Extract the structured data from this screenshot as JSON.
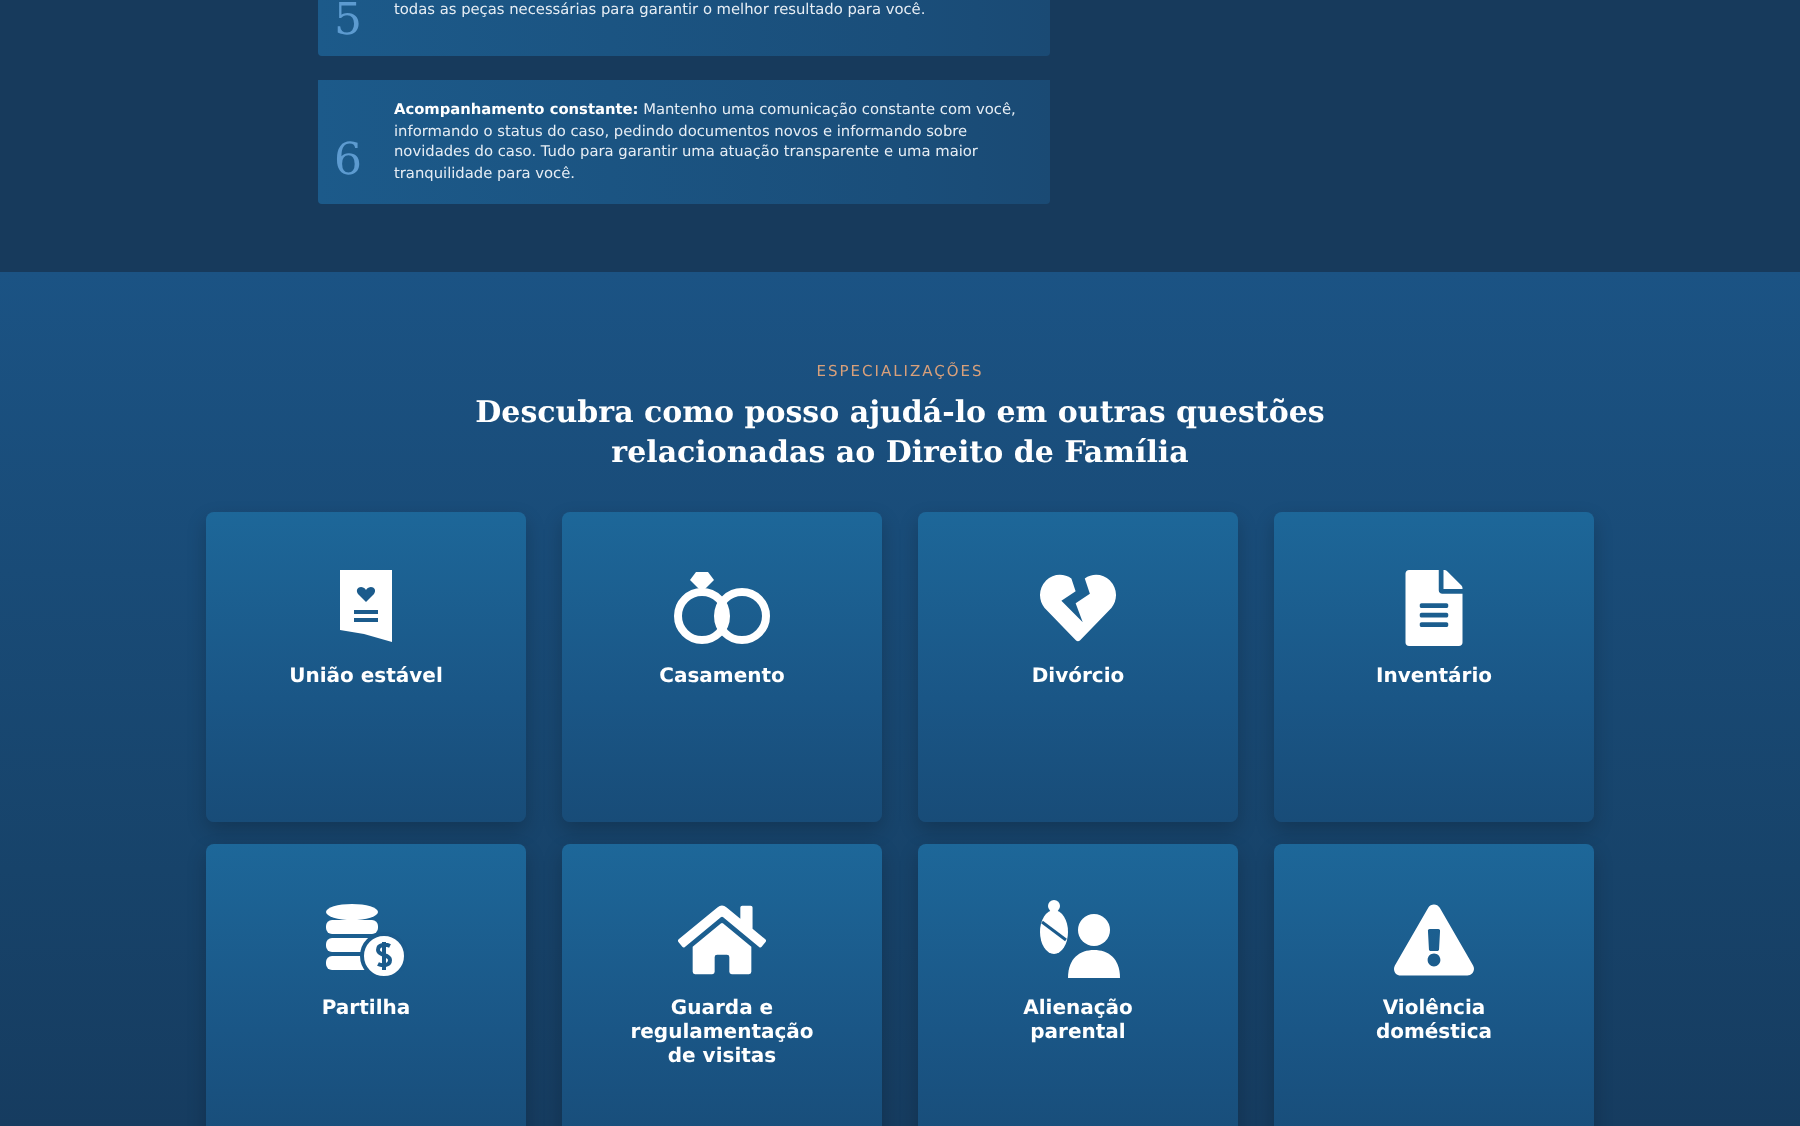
{
  "steps": [
    {
      "number": "5",
      "text": "todas as peças necessárias para garantir o melhor resultado para você."
    },
    {
      "number": "6",
      "text": "**Acompanhamento constante:** Mantenho uma comunicação constante com você, informando o status do caso, pedindo documentos novos e informando sobre novidades do caso. Tudo para garantir uma atuação transparente e uma maior tranquilidade para você."
    }
  ],
  "specializations": {
    "eyebrow": "ESPECIALIZAÇÕES",
    "heading": "Descubra como posso ajudá-lo em outras questões relacionadas ao Direito de Família",
    "cards": [
      {
        "kind": "certificate",
        "label": "União estável"
      },
      {
        "kind": "rings",
        "label": "Casamento"
      },
      {
        "kind": "broken-heart",
        "label": "Divórcio"
      },
      {
        "kind": "document",
        "label": "Inventário"
      },
      {
        "kind": "coins",
        "label": "Partilha"
      },
      {
        "kind": "house",
        "label": "Guarda e regulamentação de visitas"
      },
      {
        "kind": "parent-baby",
        "label": "Alienação parental"
      },
      {
        "kind": "warning",
        "label": "Violência doméstica"
      }
    ]
  }
}
